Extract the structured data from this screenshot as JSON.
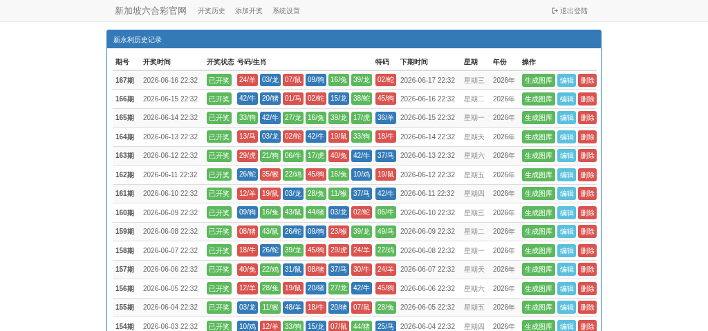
{
  "navbar": {
    "brand": "新加坡六合彩官网",
    "links": [
      "开奖历史",
      "添加开奖",
      "系统设置"
    ],
    "logout": "退出登陆"
  },
  "panel": {
    "title": "新永利历史记录",
    "columns": [
      "期号",
      "开奖时间",
      "开奖状态",
      "号码/生肖",
      "特码",
      "下期时间",
      "星期",
      "年份",
      "操作"
    ],
    "rows": [
      {
        "period": "167期",
        "time": "2026-06-16 22:32",
        "status": "已开奖",
        "balls": [
          {
            "text": "24/羊",
            "color": "#d9534f"
          },
          {
            "text": "03/龙",
            "color": "#337ab7"
          },
          {
            "text": "07/鼠",
            "color": "#d9534f"
          },
          {
            "text": "09/狗",
            "color": "#337ab7"
          },
          {
            "text": "16/兔",
            "color": "#5cb85c"
          },
          {
            "text": "39/龙",
            "color": "#5cb85c"
          }
        ],
        "special": {
          "text": "02/蛇",
          "color": "#d9534f"
        },
        "next_time": "2026-06-17 22:32",
        "weekday": "星期三",
        "year": "2026年",
        "actions": [
          "生成图库",
          "编辑",
          "删除"
        ]
      },
      {
        "period": "166期",
        "time": "2026-06-15 22:32",
        "status": "已开奖",
        "balls": [
          {
            "text": "42/牛",
            "color": "#337ab7"
          },
          {
            "text": "20/猪",
            "color": "#337ab7"
          },
          {
            "text": "01/马",
            "color": "#d9534f"
          },
          {
            "text": "02/蛇",
            "color": "#d9534f"
          },
          {
            "text": "15/龙",
            "color": "#337ab7"
          },
          {
            "text": "38/蛇",
            "color": "#5cb85c"
          }
        ],
        "special": {
          "text": "45/狗",
          "color": "#d9534f"
        },
        "next_time": "2026-06-16 22:32",
        "weekday": "星期二",
        "year": "2026年",
        "actions": [
          "生成图库",
          "编辑",
          "删除"
        ]
      },
      {
        "period": "165期",
        "time": "2026-06-14 22:32",
        "status": "已开奖",
        "balls": [
          {
            "text": "33/狗",
            "color": "#5cb85c"
          },
          {
            "text": "42/牛",
            "color": "#337ab7"
          },
          {
            "text": "27/龙",
            "color": "#5cb85c"
          },
          {
            "text": "16/兔",
            "color": "#5cb85c"
          },
          {
            "text": "39/龙",
            "color": "#5cb85c"
          },
          {
            "text": "17/虎",
            "color": "#5cb85c"
          }
        ],
        "special": {
          "text": "36/羊",
          "color": "#337ab7"
        },
        "next_time": "2026-06-15 22:32",
        "weekday": "星期一",
        "year": "2026年",
        "actions": [
          "生成图库",
          "编辑",
          "删除"
        ]
      },
      {
        "period": "164期",
        "time": "2026-06-13 22:32",
        "status": "已开奖",
        "balls": [
          {
            "text": "13/马",
            "color": "#d9534f"
          },
          {
            "text": "03/龙",
            "color": "#337ab7"
          },
          {
            "text": "02/蛇",
            "color": "#d9534f"
          },
          {
            "text": "42/牛",
            "color": "#337ab7"
          },
          {
            "text": "19/鼠",
            "color": "#d9534f"
          },
          {
            "text": "33/狗",
            "color": "#5cb85c"
          }
        ],
        "special": {
          "text": "18/牛",
          "color": "#d9534f"
        },
        "next_time": "2026-06-14 22:32",
        "weekday": "星期天",
        "year": "2026年",
        "actions": [
          "生成图库",
          "编辑",
          "删除"
        ]
      },
      {
        "period": "163期",
        "time": "2026-06-12 22:32",
        "status": "已开奖",
        "balls": [
          {
            "text": "29/虎",
            "color": "#d9534f"
          },
          {
            "text": "21/狗",
            "color": "#5cb85c"
          },
          {
            "text": "06/牛",
            "color": "#5cb85c"
          },
          {
            "text": "17/虎",
            "color": "#5cb85c"
          },
          {
            "text": "40/兔",
            "color": "#d9534f"
          },
          {
            "text": "42/牛",
            "color": "#337ab7"
          }
        ],
        "special": {
          "text": "37/马",
          "color": "#337ab7"
        },
        "next_time": "2026-06-13 22:32",
        "weekday": "星期六",
        "year": "2026年",
        "actions": [
          "生成图库",
          "编辑",
          "删除"
        ]
      },
      {
        "period": "162期",
        "time": "2026-06-11 22:32",
        "status": "已开奖",
        "balls": [
          {
            "text": "26/蛇",
            "color": "#337ab7"
          },
          {
            "text": "35/猴",
            "color": "#d9534f"
          },
          {
            "text": "22/鸡",
            "color": "#5cb85c"
          },
          {
            "text": "45/狗",
            "color": "#d9534f"
          },
          {
            "text": "16/兔",
            "color": "#5cb85c"
          },
          {
            "text": "10/鸡",
            "color": "#337ab7"
          }
        ],
        "special": {
          "text": "19/鼠",
          "color": "#d9534f"
        },
        "next_time": "2026-06-12 22:32",
        "weekday": "星期五",
        "year": "2026年",
        "actions": [
          "生成图库",
          "编辑",
          "删除"
        ]
      },
      {
        "period": "161期",
        "time": "2026-06-10 22:32",
        "status": "已开奖",
        "balls": [
          {
            "text": "12/羊",
            "color": "#d9534f"
          },
          {
            "text": "19/鼠",
            "color": "#d9534f"
          },
          {
            "text": "03/龙",
            "color": "#337ab7"
          },
          {
            "text": "28/兔",
            "color": "#5cb85c"
          },
          {
            "text": "11/猴",
            "color": "#5cb85c"
          },
          {
            "text": "37/马",
            "color": "#337ab7"
          }
        ],
        "special": {
          "text": "42/牛",
          "color": "#337ab7"
        },
        "next_time": "2026-06-11 22:32",
        "weekday": "星期四",
        "year": "2026年",
        "actions": [
          "生成图库",
          "编辑",
          "删除"
        ]
      },
      {
        "period": "160期",
        "time": "2026-06-09 22:32",
        "status": "已开奖",
        "balls": [
          {
            "text": "09/狗",
            "color": "#337ab7"
          },
          {
            "text": "16/兔",
            "color": "#5cb85c"
          },
          {
            "text": "43/鼠",
            "color": "#5cb85c"
          },
          {
            "text": "44/猪",
            "color": "#5cb85c"
          },
          {
            "text": "03/龙",
            "color": "#337ab7"
          },
          {
            "text": "02/蛇",
            "color": "#d9534f"
          }
        ],
        "special": {
          "text": "06/牛",
          "color": "#5cb85c"
        },
        "next_time": "2026-06-10 22:32",
        "weekday": "星期三",
        "year": "2026年",
        "actions": [
          "生成图库",
          "编辑",
          "删除"
        ]
      },
      {
        "period": "159期",
        "time": "2026-06-08 22:32",
        "status": "已开奖",
        "balls": [
          {
            "text": "08/猪",
            "color": "#d9534f"
          },
          {
            "text": "43/鼠",
            "color": "#5cb85c"
          },
          {
            "text": "26/蛇",
            "color": "#337ab7"
          },
          {
            "text": "09/狗",
            "color": "#337ab7"
          },
          {
            "text": "23/猴",
            "color": "#d9534f"
          },
          {
            "text": "39/龙",
            "color": "#5cb85c"
          }
        ],
        "special": {
          "text": "49/马",
          "color": "#5cb85c"
        },
        "next_time": "2026-06-09 22:32",
        "weekday": "星期二",
        "year": "2026年",
        "actions": [
          "生成图库",
          "编辑",
          "删除"
        ]
      },
      {
        "period": "158期",
        "time": "2026-06-07 22:32",
        "status": "已开奖",
        "balls": [
          {
            "text": "18/牛",
            "color": "#d9534f"
          },
          {
            "text": "26/蛇",
            "color": "#337ab7"
          },
          {
            "text": "39/龙",
            "color": "#5cb85c"
          },
          {
            "text": "45/狗",
            "color": "#d9534f"
          },
          {
            "text": "29/虎",
            "color": "#d9534f"
          },
          {
            "text": "24/羊",
            "color": "#d9534f"
          }
        ],
        "special": {
          "text": "22/鸡",
          "color": "#5cb85c"
        },
        "next_time": "2026-06-08 22:32",
        "weekday": "星期一",
        "year": "2026年",
        "actions": [
          "生成图库",
          "编辑",
          "删除"
        ]
      },
      {
        "period": "157期",
        "time": "2026-06-06 22:32",
        "status": "已开奖",
        "balls": [
          {
            "text": "40/兔",
            "color": "#d9534f"
          },
          {
            "text": "22/鸡",
            "color": "#5cb85c"
          },
          {
            "text": "31/鼠",
            "color": "#337ab7"
          },
          {
            "text": "08/猪",
            "color": "#d9534f"
          },
          {
            "text": "37/马",
            "color": "#337ab7"
          },
          {
            "text": "30/牛",
            "color": "#d9534f"
          }
        ],
        "special": {
          "text": "24/羊",
          "color": "#d9534f"
        },
        "next_time": "2026-06-07 22:32",
        "weekday": "星期天",
        "year": "2026年",
        "actions": [
          "生成图库",
          "编辑",
          "删除"
        ]
      },
      {
        "period": "156期",
        "time": "2026-06-05 22:32",
        "status": "已开奖",
        "balls": [
          {
            "text": "12/羊",
            "color": "#d9534f"
          },
          {
            "text": "28/兔",
            "color": "#5cb85c"
          },
          {
            "text": "19/鼠",
            "color": "#d9534f"
          },
          {
            "text": "20/猪",
            "color": "#337ab7"
          },
          {
            "text": "27/龙",
            "color": "#5cb85c"
          },
          {
            "text": "42/牛",
            "color": "#337ab7"
          }
        ],
        "special": {
          "text": "45/狗",
          "color": "#d9534f"
        },
        "next_time": "2026-06-06 22:32",
        "weekday": "星期六",
        "year": "2026年",
        "actions": [
          "生成图库",
          "编辑",
          "删除"
        ]
      },
      {
        "period": "155期",
        "time": "2026-06-04 22:32",
        "status": "已开奖",
        "balls": [
          {
            "text": "03/龙",
            "color": "#337ab7"
          },
          {
            "text": "11/猴",
            "color": "#5cb85c"
          },
          {
            "text": "48/羊",
            "color": "#337ab7"
          },
          {
            "text": "18/牛",
            "color": "#d9534f"
          },
          {
            "text": "20/猪",
            "color": "#337ab7"
          },
          {
            "text": "07/鼠",
            "color": "#d9534f"
          }
        ],
        "special": {
          "text": "28/兔",
          "color": "#5cb85c"
        },
        "next_time": "2026-06-05 22:32",
        "weekday": "星期五",
        "year": "2026年",
        "actions": [
          "生成图库",
          "编辑",
          "删除"
        ]
      },
      {
        "period": "154期",
        "time": "2026-06-03 22:32",
        "status": "已开奖",
        "balls": [
          {
            "text": "10/鸡",
            "color": "#337ab7"
          },
          {
            "text": "12/羊",
            "color": "#d9534f"
          },
          {
            "text": "33/狗",
            "color": "#5cb85c"
          },
          {
            "text": "15/龙",
            "color": "#337ab7"
          },
          {
            "text": "07/鼠",
            "color": "#d9534f"
          },
          {
            "text": "44/猪",
            "color": "#5cb85c"
          }
        ],
        "special": {
          "text": "25/马",
          "color": "#337ab7"
        },
        "next_time": "2026-06-04 22:32",
        "weekday": "星期四",
        "year": "2026年",
        "actions": [
          "生成图库",
          "编辑",
          "删除"
        ]
      }
    ]
  }
}
